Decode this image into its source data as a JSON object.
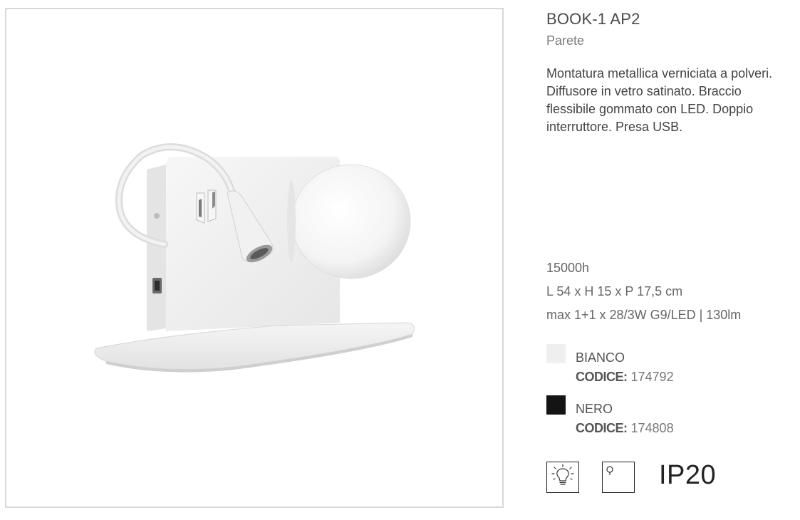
{
  "product": {
    "name": "BOOK-1 AP2",
    "category": "Parete",
    "description": "Montatura metallica verniciata a polveri. Diffusore in vetro satinato. Braccio flessibile gommato con LED. Doppio interruttore. Presa USB."
  },
  "specs": {
    "lifetime": "15000h",
    "dimensions": "L 54 x H 15 x P 17,5 cm",
    "lamp": "max 1+1 x 28/3W G9/LED | 130lm"
  },
  "variants": [
    {
      "color_name": "BIANCO",
      "code_label": "CODICE:",
      "code": "174792",
      "swatch": "#efefef"
    },
    {
      "color_name": "NERO",
      "code_label": "CODICE:",
      "code": "174808",
      "swatch": "#141414"
    }
  ],
  "icons": [
    "led-bulb-icon",
    "wall-mount-icon"
  ],
  "ip_rating": "IP20"
}
